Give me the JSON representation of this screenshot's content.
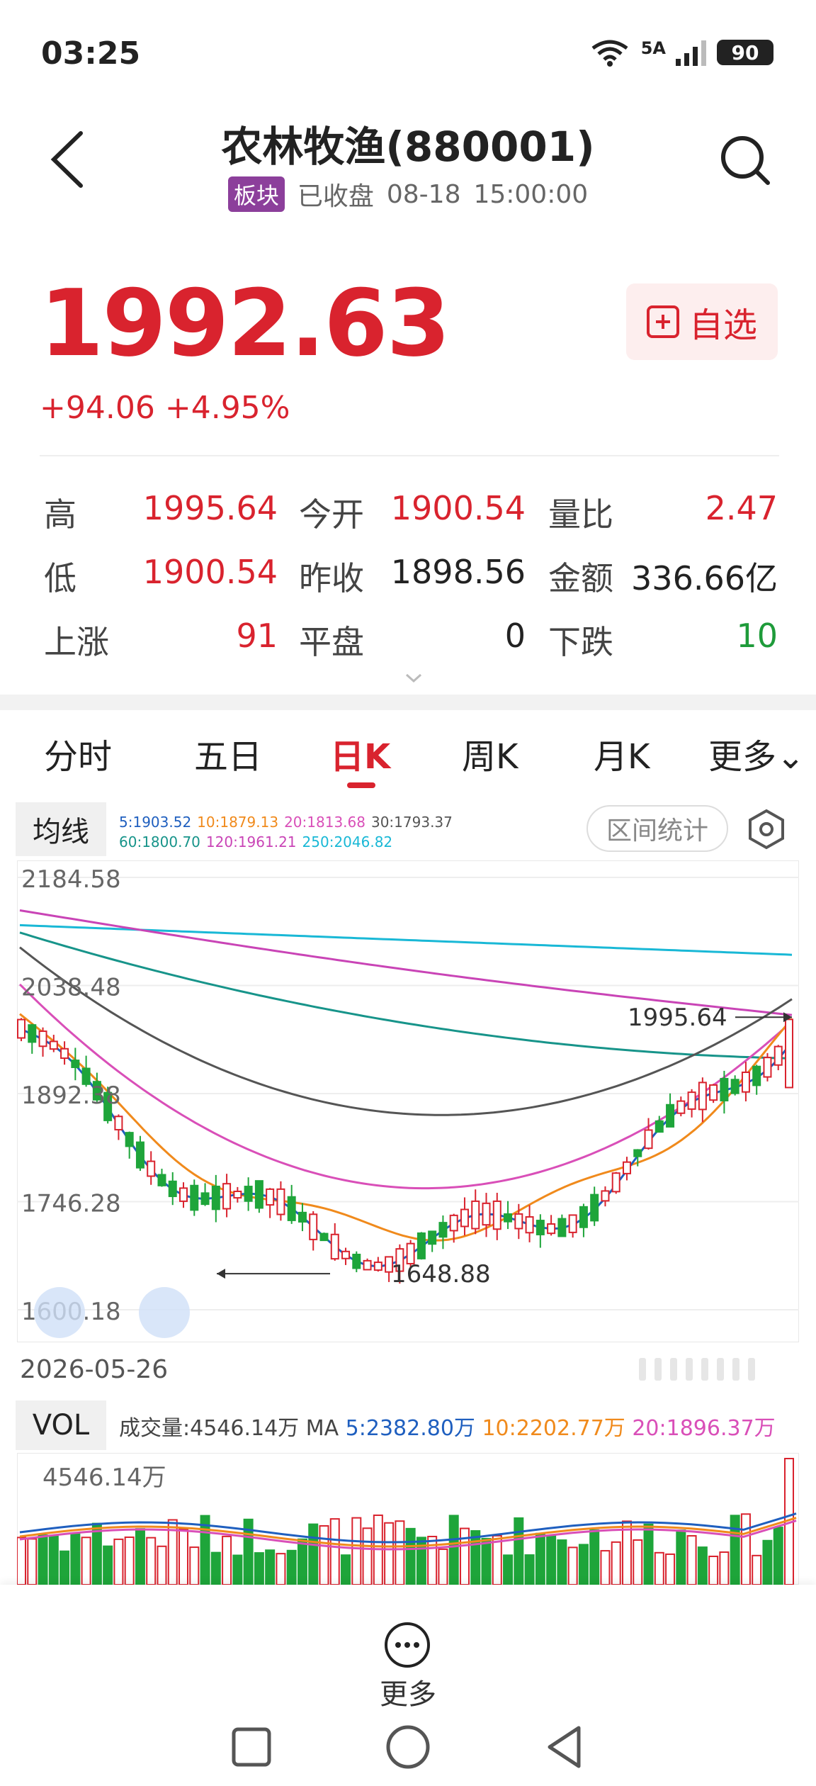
{
  "status": {
    "time": "03:25",
    "network": "5A",
    "battery": "90"
  },
  "header": {
    "title": "农林牧渔(880001)",
    "badge": "板块",
    "market_status": "已收盘",
    "date": "08-18",
    "time": "15:00:00"
  },
  "quote": {
    "price": "1992.63",
    "change": "+94.06",
    "change_pct": "+4.95%",
    "watch_label": "自选"
  },
  "stats": [
    [
      {
        "label": "高",
        "value": "1995.64",
        "color": "red"
      },
      {
        "label": "今开",
        "value": "1900.54",
        "color": "red"
      },
      {
        "label": "量比",
        "value": "2.47",
        "color": "red"
      }
    ],
    [
      {
        "label": "低",
        "value": "1900.54",
        "color": "red"
      },
      {
        "label": "昨收",
        "value": "1898.56",
        "color": "dark"
      },
      {
        "label": "金额",
        "value": "336.66亿",
        "color": "dark"
      }
    ],
    [
      {
        "label": "上涨",
        "value": "91",
        "color": "red"
      },
      {
        "label": "平盘",
        "value": "0",
        "color": "dark"
      },
      {
        "label": "下跌",
        "value": "10",
        "color": "green"
      }
    ]
  ],
  "tabs": [
    "分时",
    "五日",
    "日K",
    "周K",
    "月K",
    "更多"
  ],
  "active_tab": "日K",
  "ma_panel": {
    "label": "均线",
    "legend": [
      {
        "text": "5:1903.52",
        "color": "#1f5fbf"
      },
      {
        "text": "10:1879.13",
        "color": "#f08a1c"
      },
      {
        "text": "20:1813.68",
        "color": "#d94fb8"
      },
      {
        "text": "30:1793.37",
        "color": "#555555"
      },
      {
        "text": "60:1800.70",
        "color": "#17948a"
      },
      {
        "text": "120:1961.21",
        "color": "#c944b6"
      },
      {
        "text": "250:2046.82",
        "color": "#19b8d6"
      }
    ],
    "range_button": "区间统计"
  },
  "chart_data": {
    "type": "candlestick",
    "y_axis_labels": [
      "2184.58",
      "2038.48",
      "1892.38",
      "1746.28",
      "1600.18"
    ],
    "ylim": [
      1600.18,
      2184.58
    ],
    "start_date": "2026-05-26",
    "annotations": [
      {
        "text": "1995.64",
        "value": 1995.64,
        "position": "last"
      },
      {
        "text": "1648.88",
        "value": 1648.88,
        "position": "low"
      }
    ],
    "last_close": 1992.63,
    "last_open": 1900.54,
    "last_high": 1995.64,
    "last_low": 1900.54,
    "series_colors": {
      "up": "#d9232e",
      "down": "#1ea53a"
    }
  },
  "volume_panel": {
    "label": "VOL",
    "legend_prefix": "成交量:4546.14万 MA",
    "legend": [
      {
        "text": "5:2382.80万",
        "color": "#1f5fbf"
      },
      {
        "text": "10:2202.77万",
        "color": "#f08a1c"
      },
      {
        "text": "20:1896.37万",
        "color": "#d94fb8"
      }
    ],
    "max_label": "4546.14万"
  },
  "bottom": {
    "more_label": "更多"
  }
}
